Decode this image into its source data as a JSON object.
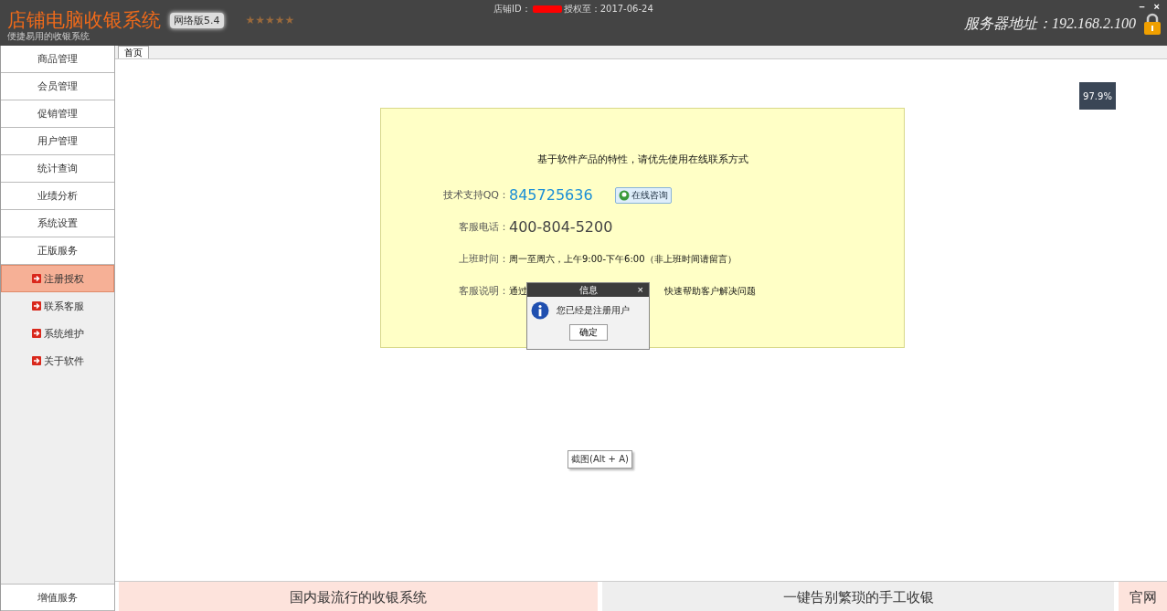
{
  "header": {
    "title": "店铺电脑收银系统",
    "subtitle": "便捷易用的收银系统",
    "edition": "网络版5.4",
    "stars": 5,
    "store_id_label": "店铺ID：",
    "license": "授权至：2017-06-24",
    "server": "服务器地址：192.168.2.100",
    "minimize": "–",
    "close": "×"
  },
  "sidebar": {
    "items": [
      {
        "label": "商品管理",
        "kind": "menu",
        "selected": false
      },
      {
        "label": "会员管理",
        "kind": "menu",
        "selected": false
      },
      {
        "label": "促销管理",
        "kind": "menu",
        "selected": false
      },
      {
        "label": "用户管理",
        "kind": "menu",
        "selected": false
      },
      {
        "label": "统计查询",
        "kind": "menu",
        "selected": false
      },
      {
        "label": "业绩分析",
        "kind": "menu",
        "selected": false
      },
      {
        "label": "系统设置",
        "kind": "menu",
        "selected": false
      },
      {
        "label": "正版服务",
        "kind": "menu",
        "selected": false
      },
      {
        "label": "注册授权",
        "kind": "sub",
        "selected": true
      },
      {
        "label": "联系客服",
        "kind": "sub",
        "selected": false
      },
      {
        "label": "系统维护",
        "kind": "sub",
        "selected": false
      },
      {
        "label": "关于软件",
        "kind": "sub",
        "selected": false
      }
    ],
    "bottom_item": "增值服务"
  },
  "tabs": [
    {
      "label": "首页",
      "selected": true
    }
  ],
  "gauge": {
    "reading": "97.9%"
  },
  "contact": {
    "notice": "基于软件产品的特性，请优先使用在线联系方式",
    "rows": [
      {
        "label": "技术支持QQ：",
        "value": "845725636",
        "kind": "qq",
        "button": "在线咨询"
      },
      {
        "label": "客服电话：",
        "value": "400-804-5200",
        "kind": "phone"
      },
      {
        "label": "上班时间：",
        "value": "周一至周六，上午9:00-下午6:00（非上班时间请留言）",
        "kind": "text"
      },
      {
        "label": "客服说明：",
        "value": "通过",
        "value_after": "快速帮助客户解决问题",
        "kind": "split"
      }
    ]
  },
  "dialog": {
    "title": "信息",
    "close": "×",
    "message": "您已经是注册用户",
    "button": "确定"
  },
  "tooltip": "截图(Alt + A)",
  "banners": [
    {
      "text": "国内最流行的收银系统",
      "kind": "pink"
    },
    {
      "text": "一键告别繁琐的手工收银",
      "kind": "grey"
    },
    {
      "text": "官网",
      "kind": "pink"
    }
  ]
}
